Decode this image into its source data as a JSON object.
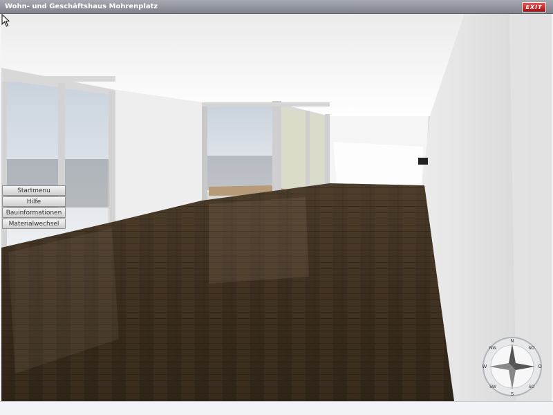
{
  "window": {
    "title": "Wohn- und Geschäftshaus Mohrenplatz",
    "exit_label": "EXIT"
  },
  "menu": {
    "items": [
      {
        "label": "Startmenu"
      },
      {
        "label": "Hilfe"
      },
      {
        "label": "Bauinformationen"
      },
      {
        "label": "Materialwechsel"
      }
    ]
  },
  "compass": {
    "n": "N",
    "no": "NO",
    "o": "O",
    "so": "SO",
    "s": "S",
    "sw": "SW",
    "w": "W",
    "nw": "NW"
  },
  "colors": {
    "titlebar": "#8f939b",
    "exit": "#cc2222",
    "floor": "#3b2e20",
    "walls": "#f2f2f2"
  }
}
